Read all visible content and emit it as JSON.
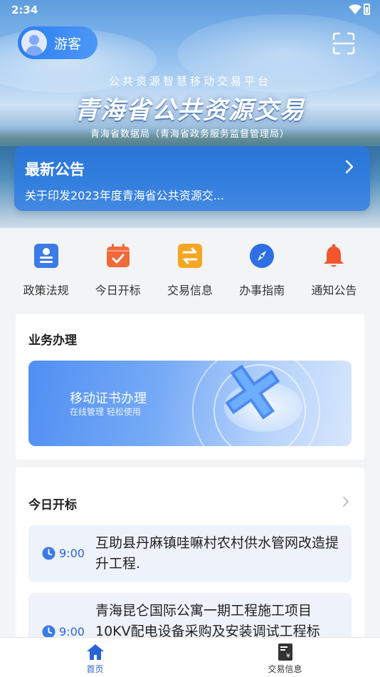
{
  "status_bar": {
    "time": "2:34"
  },
  "header": {
    "user_label": "游客",
    "subtitle": "公共资源智慧移动交易平台",
    "title": "青海省公共资源交易",
    "org": "青海省数据局（青海省政务服务监督管理局）"
  },
  "notice": {
    "title": "最新公告",
    "text": "关于印发2023年度青海省公共资源交..."
  },
  "quick_nav": [
    {
      "label": "政策法规",
      "icon": "policy-icon",
      "color": "#3a7be8"
    },
    {
      "label": "今日开标",
      "icon": "calendar-check-icon",
      "color": "#f06a3a"
    },
    {
      "label": "交易信息",
      "icon": "exchange-icon",
      "color": "#f5a623"
    },
    {
      "label": "办事指南",
      "icon": "compass-icon",
      "color": "#2f6fe4"
    },
    {
      "label": "通知公告",
      "icon": "bell-icon",
      "color": "#f0572f"
    }
  ],
  "business": {
    "title": "业务办理",
    "banner_title": "移动证书办理",
    "banner_sub": "在线管理 轻松使用"
  },
  "bids": {
    "title": "今日开标",
    "items": [
      {
        "time": "9:00",
        "desc": "互助县丹麻镇哇嘛村农村供水管网改造提升工程."
      },
      {
        "time": "9:00",
        "desc": "青海昆仑国际公寓一期工程施工项目10KV配电设备采购及安装调试工程标"
      }
    ]
  },
  "tabbar": {
    "tabs": [
      {
        "label": "首页",
        "icon": "home-icon",
        "active": true
      },
      {
        "label": "交易信息",
        "icon": "trade-doc-icon",
        "active": false
      }
    ]
  },
  "colors": {
    "accent": "#2a63d8"
  }
}
